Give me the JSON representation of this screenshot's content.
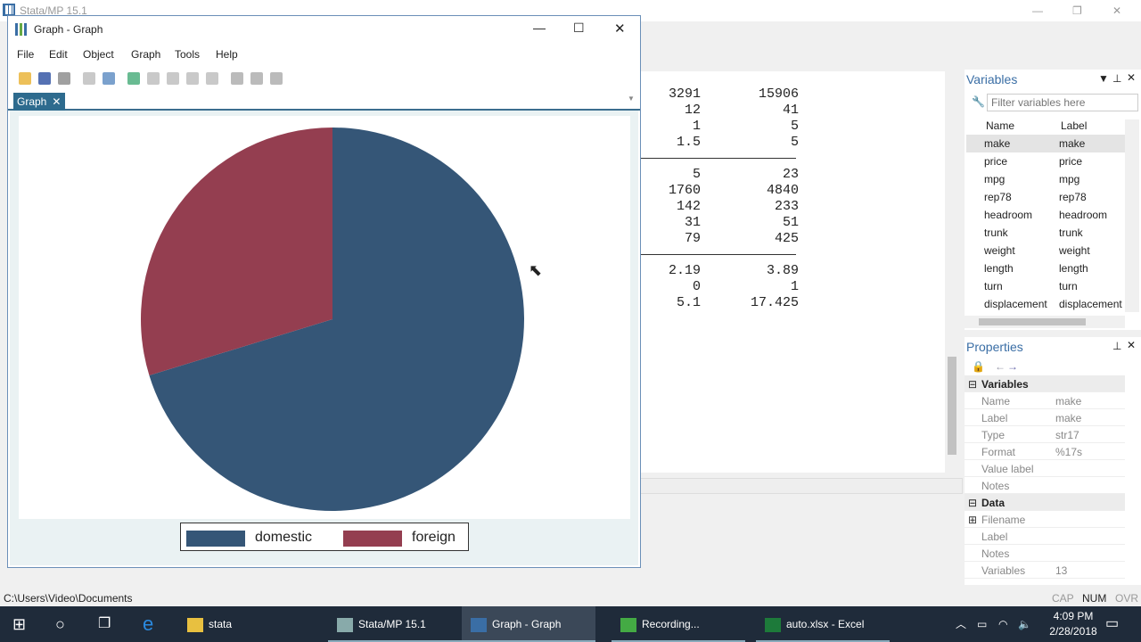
{
  "main_window": {
    "title": "Stata/MP 15.1"
  },
  "results": {
    "rows": [
      [
        "3291",
        "15906"
      ],
      [
        "12",
        "41"
      ],
      [
        "1",
        "5"
      ],
      [
        "1.5",
        "5"
      ],
      null,
      [
        "5",
        "23"
      ],
      [
        "1760",
        "4840"
      ],
      [
        "142",
        "233"
      ],
      [
        "31",
        "51"
      ],
      [
        "79",
        "425"
      ],
      null,
      [
        "2.19",
        "3.89"
      ],
      [
        "0",
        "1"
      ],
      [
        "5.1",
        "17.425"
      ]
    ]
  },
  "variables_panel": {
    "title": "Variables",
    "filter_placeholder": "Filter variables here",
    "columns": [
      "Name",
      "Label"
    ],
    "items": [
      {
        "name": "make",
        "label": "make"
      },
      {
        "name": "price",
        "label": "price"
      },
      {
        "name": "mpg",
        "label": "mpg"
      },
      {
        "name": "rep78",
        "label": "rep78"
      },
      {
        "name": "headroom",
        "label": "headroom"
      },
      {
        "name": "trunk",
        "label": "trunk"
      },
      {
        "name": "weight",
        "label": "weight"
      },
      {
        "name": "length",
        "label": "length"
      },
      {
        "name": "turn",
        "label": "turn"
      },
      {
        "name": "displacement",
        "label": "displacement"
      }
    ]
  },
  "properties_panel": {
    "title": "Properties",
    "sections": [
      {
        "title": "Variables",
        "rows": [
          [
            "Name",
            "make"
          ],
          [
            "Label",
            "make"
          ],
          [
            "Type",
            "str17"
          ],
          [
            "Format",
            "%17s"
          ],
          [
            "Value label",
            ""
          ],
          [
            "Notes",
            ""
          ]
        ]
      },
      {
        "title": "Data",
        "rows": [
          [
            "Filename",
            ""
          ],
          [
            "Label",
            ""
          ],
          [
            "Notes",
            ""
          ],
          [
            "Variables",
            "13"
          ]
        ]
      }
    ]
  },
  "status": {
    "path": "C:\\Users\\Video\\Documents",
    "cap": "CAP",
    "num": "NUM",
    "ovr": "OVR"
  },
  "graph_window": {
    "title": "Graph - Graph",
    "menu": [
      "File",
      "Edit",
      "Object",
      "Graph",
      "Tools",
      "Help"
    ],
    "tab": "Graph"
  },
  "chart_data": {
    "type": "pie",
    "categories": [
      "domestic",
      "foreign"
    ],
    "values": [
      52,
      22
    ],
    "colors": [
      "#355677",
      "#943e50"
    ],
    "legend": "bottom",
    "start": "12 o'clock, clockwise"
  },
  "taskbar": {
    "items": [
      "stata",
      "Stata/MP 15.1",
      "Graph - Graph",
      "Recording...",
      "auto.xlsx - Excel"
    ],
    "time": "4:09 PM",
    "date": "2/28/2018"
  }
}
